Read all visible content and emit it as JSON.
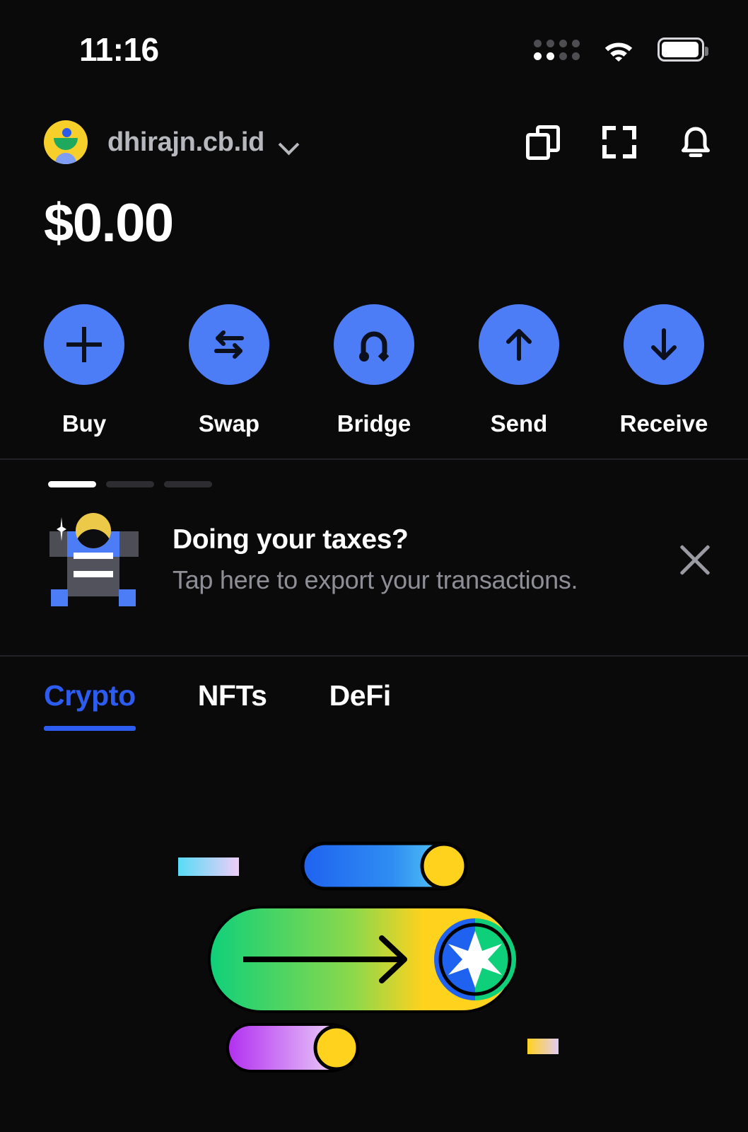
{
  "status_bar": {
    "time": "11:16",
    "signal_icon": "signal-dots-icon",
    "wifi_icon": "wifi-icon",
    "battery_icon": "battery-icon"
  },
  "header": {
    "avatar_icon": "avatar-icon",
    "account_name": "dhirajn.cb.id",
    "chevron_icon": "chevron-down-icon",
    "actions": [
      {
        "name": "copy-address-button",
        "icon": "copy-icon"
      },
      {
        "name": "scan-qr-button",
        "icon": "scan-qr-icon"
      },
      {
        "name": "notifications-button",
        "icon": "bell-icon"
      }
    ]
  },
  "balance": {
    "amount": "$0.00"
  },
  "quick_actions": [
    {
      "label": "Buy",
      "icon": "plus-icon"
    },
    {
      "label": "Swap",
      "icon": "swap-arrows-icon"
    },
    {
      "label": "Bridge",
      "icon": "bridge-arch-icon"
    },
    {
      "label": "Send",
      "icon": "arrow-up-icon"
    },
    {
      "label": "Receive",
      "icon": "arrow-down-icon"
    }
  ],
  "promo": {
    "pager": {
      "count": 3,
      "active_index": 0
    },
    "art_icon": "tax-document-icon",
    "title": "Doing your taxes?",
    "subtitle": "Tap here to export your transactions.",
    "close_icon": "close-icon"
  },
  "tabs": [
    {
      "label": "Crypto",
      "active": true
    },
    {
      "label": "NFTs",
      "active": false
    },
    {
      "label": "DeFi",
      "active": false
    }
  ],
  "empty_state": {
    "illustration_icon": "swap-toggle-illustration-icon"
  },
  "colors": {
    "background": "#0a0a0b",
    "accent_blue": "#4d7cf7",
    "tab_active_blue": "#2d5cf0",
    "avatar_yellow": "#f7cf2b",
    "text_primary": "#ffffff",
    "text_secondary": "#8e8e96",
    "divider": "#232327",
    "illustration_green": "#13cf7a",
    "illustration_yellow": "#ffd21e",
    "illustration_purple": "#b43df0",
    "illustration_cyan": "#5fd8f5"
  }
}
